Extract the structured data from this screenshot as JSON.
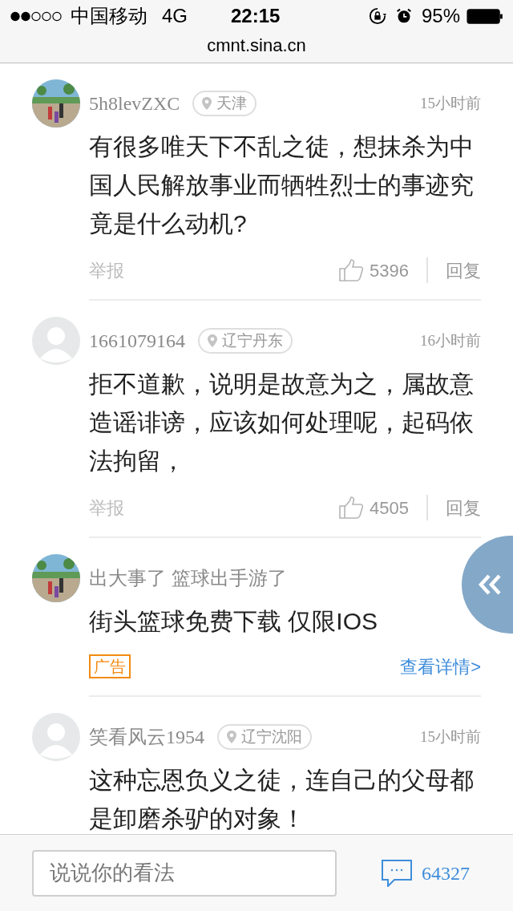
{
  "status_bar": {
    "carrier": "中国移动",
    "network": "4G",
    "time": "22:15",
    "battery": "95%"
  },
  "address_bar": {
    "url": "cmnt.sina.cn"
  },
  "feed": [
    {
      "kind": "comment",
      "photo": true,
      "user": "5h8levZXC",
      "location": "天津",
      "time": "15小时前",
      "text": "有很多唯天下不乱之徒，想抹杀为中国人民解放事业而牺牲烈士的事迹究竟是什么动机?",
      "report": "举报",
      "likes": "5396",
      "reply": "回复"
    },
    {
      "kind": "comment",
      "photo": false,
      "user": "1661079164",
      "location": "辽宁丹东",
      "time": "16小时前",
      "text": "拒不道歉，说明是故意为之，属故意造谣诽谤，应该如何处理呢，起码依法拘留，",
      "report": "举报",
      "likes": "4505",
      "reply": "回复"
    },
    {
      "kind": "ad",
      "photo": true,
      "title": "出大事了 篮球出手游了",
      "text": "街头篮球免费下载 仅限IOS",
      "badge": "广告",
      "link": "查看详情>"
    },
    {
      "kind": "comment",
      "photo": false,
      "user": "笑看风云1954",
      "location": "辽宁沈阳",
      "time": "15小时前",
      "text": "这种忘恩负义之徒，连自己的父母都是卸磨杀驴的对象！"
    }
  ],
  "bottom_bar": {
    "placeholder": "说说你的看法",
    "comment_count": "64327"
  }
}
